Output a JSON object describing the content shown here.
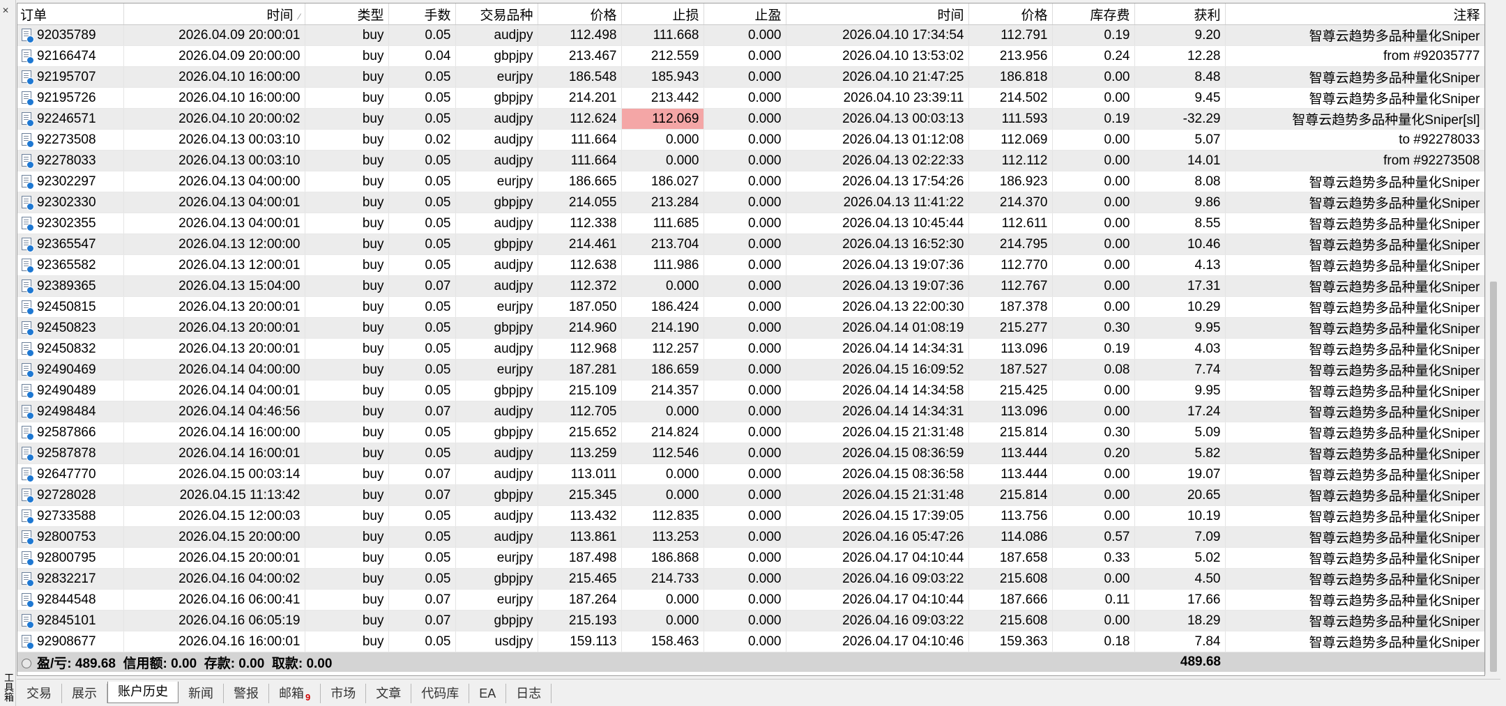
{
  "side_label": "工具箱",
  "columns": [
    "订单",
    "时间",
    "类型",
    "手数",
    "交易品种",
    "价格",
    "止损",
    "止盈",
    "时间",
    "价格",
    "库存费",
    "获利",
    "注释"
  ],
  "sort_indicator": "⁄",
  "rows": [
    [
      "92035789",
      "2026.04.09 20:00:01",
      "buy",
      "0.05",
      "audjpy",
      "112.498",
      "111.668",
      "0.000",
      "2026.04.10 17:34:54",
      "112.791",
      "0.19",
      "9.20",
      "智尊云趋势多品种量化Sniper"
    ],
    [
      "92166474",
      "2026.04.09 20:00:00",
      "buy",
      "0.04",
      "gbpjpy",
      "213.467",
      "212.559",
      "0.000",
      "2026.04.10 13:53:02",
      "213.956",
      "0.24",
      "12.28",
      "from #92035777"
    ],
    [
      "92195707",
      "2026.04.10 16:00:00",
      "buy",
      "0.05",
      "eurjpy",
      "186.548",
      "185.943",
      "0.000",
      "2026.04.10 21:47:25",
      "186.818",
      "0.00",
      "8.48",
      "智尊云趋势多品种量化Sniper"
    ],
    [
      "92195726",
      "2026.04.10 16:00:00",
      "buy",
      "0.05",
      "gbpjpy",
      "214.201",
      "213.442",
      "0.000",
      "2026.04.10 23:39:11",
      "214.502",
      "0.00",
      "9.45",
      "智尊云趋势多品种量化Sniper"
    ],
    [
      "92246571",
      "2026.04.10 20:00:02",
      "buy",
      "0.05",
      "audjpy",
      "112.624",
      "112.069",
      "0.000",
      "2026.04.13 00:03:13",
      "111.593",
      "0.19",
      "-32.29",
      "智尊云趋势多品种量化Sniper[sl]"
    ],
    [
      "92273508",
      "2026.04.13 00:03:10",
      "buy",
      "0.02",
      "audjpy",
      "111.664",
      "0.000",
      "0.000",
      "2026.04.13 01:12:08",
      "112.069",
      "0.00",
      "5.07",
      "to #92278033"
    ],
    [
      "92278033",
      "2026.04.13 00:03:10",
      "buy",
      "0.05",
      "audjpy",
      "111.664",
      "0.000",
      "0.000",
      "2026.04.13 02:22:33",
      "112.112",
      "0.00",
      "14.01",
      "from #92273508"
    ],
    [
      "92302297",
      "2026.04.13 04:00:00",
      "buy",
      "0.05",
      "eurjpy",
      "186.665",
      "186.027",
      "0.000",
      "2026.04.13 17:54:26",
      "186.923",
      "0.00",
      "8.08",
      "智尊云趋势多品种量化Sniper"
    ],
    [
      "92302330",
      "2026.04.13 04:00:01",
      "buy",
      "0.05",
      "gbpjpy",
      "214.055",
      "213.284",
      "0.000",
      "2026.04.13 11:41:22",
      "214.370",
      "0.00",
      "9.86",
      "智尊云趋势多品种量化Sniper"
    ],
    [
      "92302355",
      "2026.04.13 04:00:01",
      "buy",
      "0.05",
      "audjpy",
      "112.338",
      "111.685",
      "0.000",
      "2026.04.13 10:45:44",
      "112.611",
      "0.00",
      "8.55",
      "智尊云趋势多品种量化Sniper"
    ],
    [
      "92365547",
      "2026.04.13 12:00:00",
      "buy",
      "0.05",
      "gbpjpy",
      "214.461",
      "213.704",
      "0.000",
      "2026.04.13 16:52:30",
      "214.795",
      "0.00",
      "10.46",
      "智尊云趋势多品种量化Sniper"
    ],
    [
      "92365582",
      "2026.04.13 12:00:01",
      "buy",
      "0.05",
      "audjpy",
      "112.638",
      "111.986",
      "0.000",
      "2026.04.13 19:07:36",
      "112.770",
      "0.00",
      "4.13",
      "智尊云趋势多品种量化Sniper"
    ],
    [
      "92389365",
      "2026.04.13 15:04:00",
      "buy",
      "0.07",
      "audjpy",
      "112.372",
      "0.000",
      "0.000",
      "2026.04.13 19:07:36",
      "112.767",
      "0.00",
      "17.31",
      "智尊云趋势多品种量化Sniper"
    ],
    [
      "92450815",
      "2026.04.13 20:00:01",
      "buy",
      "0.05",
      "eurjpy",
      "187.050",
      "186.424",
      "0.000",
      "2026.04.13 22:00:30",
      "187.378",
      "0.00",
      "10.29",
      "智尊云趋势多品种量化Sniper"
    ],
    [
      "92450823",
      "2026.04.13 20:00:01",
      "buy",
      "0.05",
      "gbpjpy",
      "214.960",
      "214.190",
      "0.000",
      "2026.04.14 01:08:19",
      "215.277",
      "0.30",
      "9.95",
      "智尊云趋势多品种量化Sniper"
    ],
    [
      "92450832",
      "2026.04.13 20:00:01",
      "buy",
      "0.05",
      "audjpy",
      "112.968",
      "112.257",
      "0.000",
      "2026.04.14 14:34:31",
      "113.096",
      "0.19",
      "4.03",
      "智尊云趋势多品种量化Sniper"
    ],
    [
      "92490469",
      "2026.04.14 04:00:00",
      "buy",
      "0.05",
      "eurjpy",
      "187.281",
      "186.659",
      "0.000",
      "2026.04.15 16:09:52",
      "187.527",
      "0.08",
      "7.74",
      "智尊云趋势多品种量化Sniper"
    ],
    [
      "92490489",
      "2026.04.14 04:00:01",
      "buy",
      "0.05",
      "gbpjpy",
      "215.109",
      "214.357",
      "0.000",
      "2026.04.14 14:34:58",
      "215.425",
      "0.00",
      "9.95",
      "智尊云趋势多品种量化Sniper"
    ],
    [
      "92498484",
      "2026.04.14 04:46:56",
      "buy",
      "0.07",
      "audjpy",
      "112.705",
      "0.000",
      "0.000",
      "2026.04.14 14:34:31",
      "113.096",
      "0.00",
      "17.24",
      "智尊云趋势多品种量化Sniper"
    ],
    [
      "92587866",
      "2026.04.14 16:00:00",
      "buy",
      "0.05",
      "gbpjpy",
      "215.652",
      "214.824",
      "0.000",
      "2026.04.15 21:31:48",
      "215.814",
      "0.30",
      "5.09",
      "智尊云趋势多品种量化Sniper"
    ],
    [
      "92587878",
      "2026.04.14 16:00:01",
      "buy",
      "0.05",
      "audjpy",
      "113.259",
      "112.546",
      "0.000",
      "2026.04.15 08:36:59",
      "113.444",
      "0.20",
      "5.82",
      "智尊云趋势多品种量化Sniper"
    ],
    [
      "92647770",
      "2026.04.15 00:03:14",
      "buy",
      "0.07",
      "audjpy",
      "113.011",
      "0.000",
      "0.000",
      "2026.04.15 08:36:58",
      "113.444",
      "0.00",
      "19.07",
      "智尊云趋势多品种量化Sniper"
    ],
    [
      "92728028",
      "2026.04.15 11:13:42",
      "buy",
      "0.07",
      "gbpjpy",
      "215.345",
      "0.000",
      "0.000",
      "2026.04.15 21:31:48",
      "215.814",
      "0.00",
      "20.65",
      "智尊云趋势多品种量化Sniper"
    ],
    [
      "92733588",
      "2026.04.15 12:00:03",
      "buy",
      "0.05",
      "audjpy",
      "113.432",
      "112.835",
      "0.000",
      "2026.04.15 17:39:05",
      "113.756",
      "0.00",
      "10.19",
      "智尊云趋势多品种量化Sniper"
    ],
    [
      "92800753",
      "2026.04.15 20:00:00",
      "buy",
      "0.05",
      "audjpy",
      "113.861",
      "113.253",
      "0.000",
      "2026.04.16 05:47:26",
      "114.086",
      "0.57",
      "7.09",
      "智尊云趋势多品种量化Sniper"
    ],
    [
      "92800795",
      "2026.04.15 20:00:01",
      "buy",
      "0.05",
      "eurjpy",
      "187.498",
      "186.868",
      "0.000",
      "2026.04.17 04:10:44",
      "187.658",
      "0.33",
      "5.02",
      "智尊云趋势多品种量化Sniper"
    ],
    [
      "92832217",
      "2026.04.16 04:00:02",
      "buy",
      "0.05",
      "gbpjpy",
      "215.465",
      "214.733",
      "0.000",
      "2026.04.16 09:03:22",
      "215.608",
      "0.00",
      "4.50",
      "智尊云趋势多品种量化Sniper"
    ],
    [
      "92844548",
      "2026.04.16 06:00:41",
      "buy",
      "0.07",
      "eurjpy",
      "187.264",
      "0.000",
      "0.000",
      "2026.04.17 04:10:44",
      "187.666",
      "0.11",
      "17.66",
      "智尊云趋势多品种量化Sniper"
    ],
    [
      "92845101",
      "2026.04.16 06:05:19",
      "buy",
      "0.07",
      "gbpjpy",
      "215.193",
      "0.000",
      "0.000",
      "2026.04.16 09:03:22",
      "215.608",
      "0.00",
      "18.29",
      "智尊云趋势多品种量化Sniper"
    ],
    [
      "92908677",
      "2026.04.16 16:00:01",
      "buy",
      "0.05",
      "usdjpy",
      "159.113",
      "158.463",
      "0.000",
      "2026.04.17 04:10:46",
      "159.363",
      "0.18",
      "7.84",
      "智尊云趋势多品种量化Sniper"
    ]
  ],
  "highlight": {
    "row": 4,
    "col": 6,
    "color": "#f4a6a6"
  },
  "summary": {
    "text": "盈/亏: 489.68  信用额: 0.00  存款: 0.00  取款: 0.00",
    "total_profit": "489.68"
  },
  "tabs": [
    {
      "label": "交易",
      "active": false
    },
    {
      "label": "展示",
      "active": false
    },
    {
      "label": "账户历史",
      "active": true
    },
    {
      "label": "新闻",
      "active": false
    },
    {
      "label": "警报",
      "active": false
    },
    {
      "label": "邮箱",
      "active": false,
      "badge": "9"
    },
    {
      "label": "市场",
      "active": false
    },
    {
      "label": "文章",
      "active": false
    },
    {
      "label": "代码库",
      "active": false
    },
    {
      "label": "EA",
      "active": false
    },
    {
      "label": "日志",
      "active": false
    }
  ]
}
